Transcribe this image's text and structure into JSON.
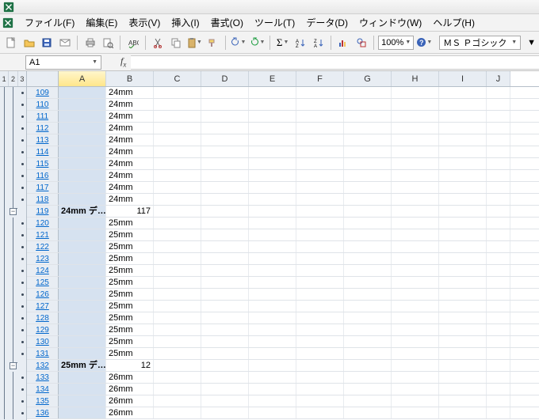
{
  "menu": {
    "file": "ファイル(F)",
    "edit": "編集(E)",
    "view": "表示(V)",
    "insert": "挿入(I)",
    "format": "書式(O)",
    "tools": "ツール(T)",
    "data": "データ(D)",
    "window": "ウィンドウ(W)",
    "help": "ヘルプ(H)"
  },
  "toolbar": {
    "zoom": "100%",
    "font": "ＭＳ Ｐゴシック"
  },
  "namebox": {
    "value": "A1"
  },
  "outline": {
    "l1": "1",
    "l2": "2",
    "l3": "3"
  },
  "columns": [
    "A",
    "B",
    "C",
    "D",
    "E",
    "F",
    "G",
    "H",
    "I",
    "J"
  ],
  "chart_data": {
    "type": "table",
    "columns": [
      "row",
      "A",
      "B"
    ],
    "rows": [
      {
        "row": "109",
        "A": "",
        "B": "24mm"
      },
      {
        "row": "110",
        "A": "",
        "B": "24mm"
      },
      {
        "row": "111",
        "A": "",
        "B": "24mm"
      },
      {
        "row": "112",
        "A": "",
        "B": "24mm"
      },
      {
        "row": "113",
        "A": "",
        "B": "24mm"
      },
      {
        "row": "114",
        "A": "",
        "B": "24mm"
      },
      {
        "row": "115",
        "A": "",
        "B": "24mm"
      },
      {
        "row": "116",
        "A": "",
        "B": "24mm"
      },
      {
        "row": "117",
        "A": "",
        "B": "24mm"
      },
      {
        "row": "118",
        "A": "",
        "B": "24mm"
      },
      {
        "row": "119",
        "A": "24mm デ…",
        "B": "117",
        "subtotal": true,
        "num": true
      },
      {
        "row": "120",
        "A": "",
        "B": "25mm"
      },
      {
        "row": "121",
        "A": "",
        "B": "25mm"
      },
      {
        "row": "122",
        "A": "",
        "B": "25mm"
      },
      {
        "row": "123",
        "A": "",
        "B": "25mm"
      },
      {
        "row": "124",
        "A": "",
        "B": "25mm"
      },
      {
        "row": "125",
        "A": "",
        "B": "25mm"
      },
      {
        "row": "126",
        "A": "",
        "B": "25mm"
      },
      {
        "row": "127",
        "A": "",
        "B": "25mm"
      },
      {
        "row": "128",
        "A": "",
        "B": "25mm"
      },
      {
        "row": "129",
        "A": "",
        "B": "25mm"
      },
      {
        "row": "130",
        "A": "",
        "B": "25mm"
      },
      {
        "row": "131",
        "A": "",
        "B": "25mm"
      },
      {
        "row": "132",
        "A": "25mm デ…",
        "B": "12",
        "subtotal": true,
        "num": true
      },
      {
        "row": "133",
        "A": "",
        "B": "26mm"
      },
      {
        "row": "134",
        "A": "",
        "B": "26mm"
      },
      {
        "row": "135",
        "A": "",
        "B": "26mm"
      },
      {
        "row": "136",
        "A": "",
        "B": "26mm"
      }
    ]
  }
}
